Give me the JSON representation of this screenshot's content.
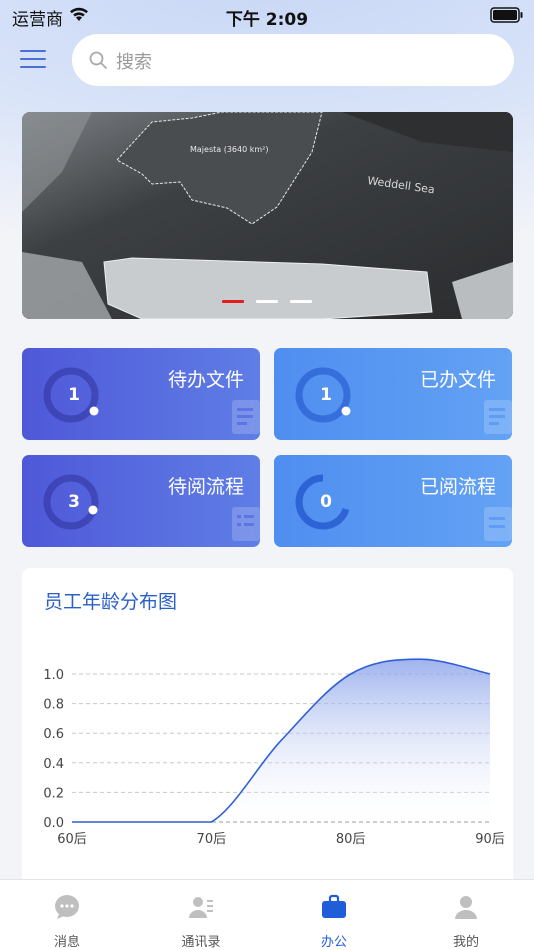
{
  "status_bar": {
    "carrier": "运营商",
    "time": "下午 2:09"
  },
  "search": {
    "placeholder": "搜索"
  },
  "banner": {
    "map_labels": [
      "Majesta (3640 km²)",
      "Weddell Sea"
    ],
    "slide_count": 3,
    "active_slide": 0,
    "active_color": "#e02020"
  },
  "cards": [
    {
      "title": "待办文件",
      "count": "1",
      "style": "purple"
    },
    {
      "title": "已办文件",
      "count": "1",
      "style": "blue"
    },
    {
      "title": "待阅流程",
      "count": "3",
      "style": "purple"
    },
    {
      "title": "已阅流程",
      "count": "0",
      "style": "blue"
    }
  ],
  "chart": {
    "title": "员工年龄分布图"
  },
  "chart_data": {
    "type": "area",
    "title": "员工年龄分布图",
    "categories": [
      "60后",
      "70后",
      "80后",
      "90后"
    ],
    "x": [
      0,
      0.5,
      1,
      1.5,
      2,
      2.5,
      3
    ],
    "values": [
      0,
      0,
      0,
      0.55,
      1.0,
      1.1,
      1.0
    ],
    "yticks": [
      "0.0",
      "0.2",
      "0.4",
      "0.6",
      "0.8",
      "1.0"
    ],
    "ylim": [
      0,
      1.0
    ],
    "smooth": true,
    "grid": "dashed-horizontal",
    "line_color": "#2f5fd6"
  },
  "tabs": [
    {
      "label": "消息",
      "icon": "message-icon",
      "active": false
    },
    {
      "label": "通讯录",
      "icon": "contacts-icon",
      "active": false
    },
    {
      "label": "办公",
      "icon": "briefcase-icon",
      "active": true
    },
    {
      "label": "我的",
      "icon": "user-icon",
      "active": false
    }
  ]
}
